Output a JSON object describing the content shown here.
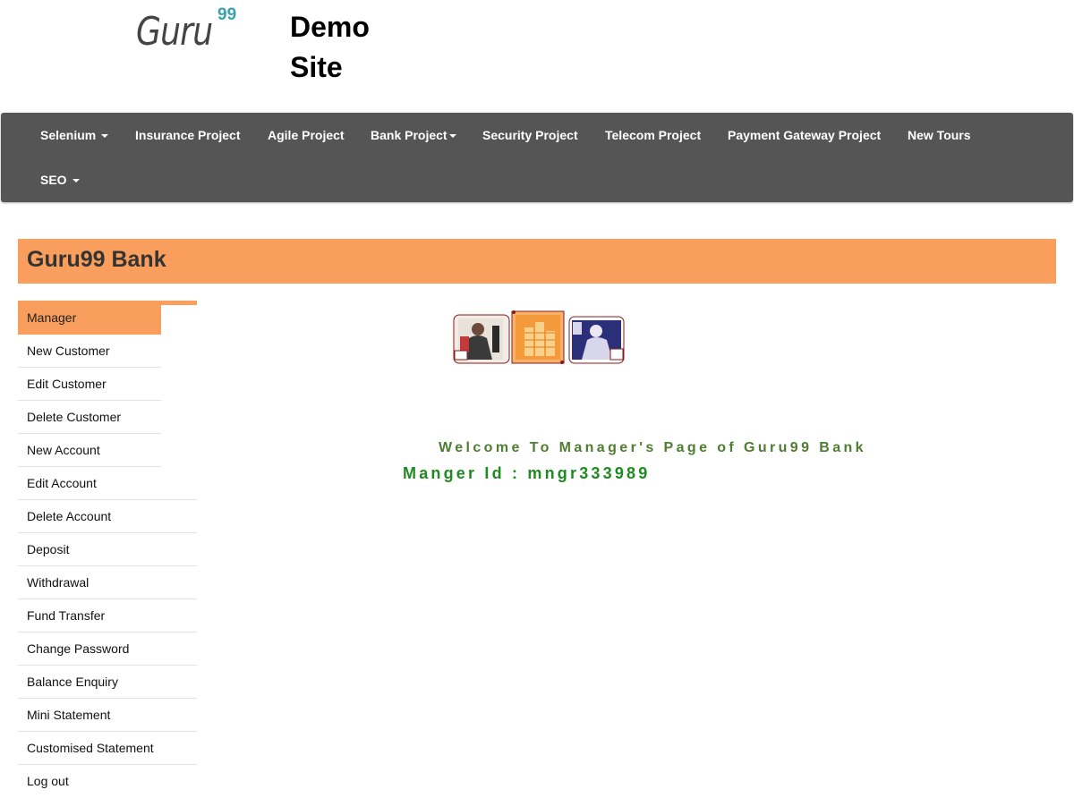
{
  "header": {
    "logo_text": "Guru",
    "logo_superscript": "99",
    "site_title_line1": "Demo",
    "site_title_line2": "Site"
  },
  "navbar": {
    "items": [
      {
        "label": "Selenium",
        "dropdown": true
      },
      {
        "label": "Insurance Project",
        "dropdown": false
      },
      {
        "label": "Agile Project",
        "dropdown": false
      },
      {
        "label": "Bank Project",
        "dropdown": true
      },
      {
        "label": "Security Project",
        "dropdown": false
      },
      {
        "label": "Telecom Project",
        "dropdown": false
      },
      {
        "label": "Payment Gateway Project",
        "dropdown": false
      },
      {
        "label": "New Tours",
        "dropdown": false
      },
      {
        "label": "SEO",
        "dropdown": true
      }
    ]
  },
  "bank": {
    "title": "Guru99 Bank"
  },
  "sidebar": {
    "items": [
      {
        "label": "Manager",
        "active": true
      },
      {
        "label": "New Customer"
      },
      {
        "label": "Edit Customer"
      },
      {
        "label": "Delete Customer"
      },
      {
        "label": "New Account"
      },
      {
        "label": "Edit Account"
      },
      {
        "label": "Delete Account"
      },
      {
        "label": "Deposit"
      },
      {
        "label": "Withdrawal"
      },
      {
        "label": "Fund Transfer"
      },
      {
        "label": "Change Password"
      },
      {
        "label": "Balance Enquiry"
      },
      {
        "label": "Mini Statement"
      },
      {
        "label": "Customised Statement"
      },
      {
        "label": "Log out"
      }
    ]
  },
  "main": {
    "welcome_text": "Welcome To Manager's Page of Guru99 Bank",
    "manager_id_text": "Manger Id : mngr333989"
  },
  "colors": {
    "navbar_bg": "#555555",
    "accent_orange": "#f99e5c",
    "welcome_green": "#4f7d32",
    "manager_id_green": "#1f8a1f"
  }
}
